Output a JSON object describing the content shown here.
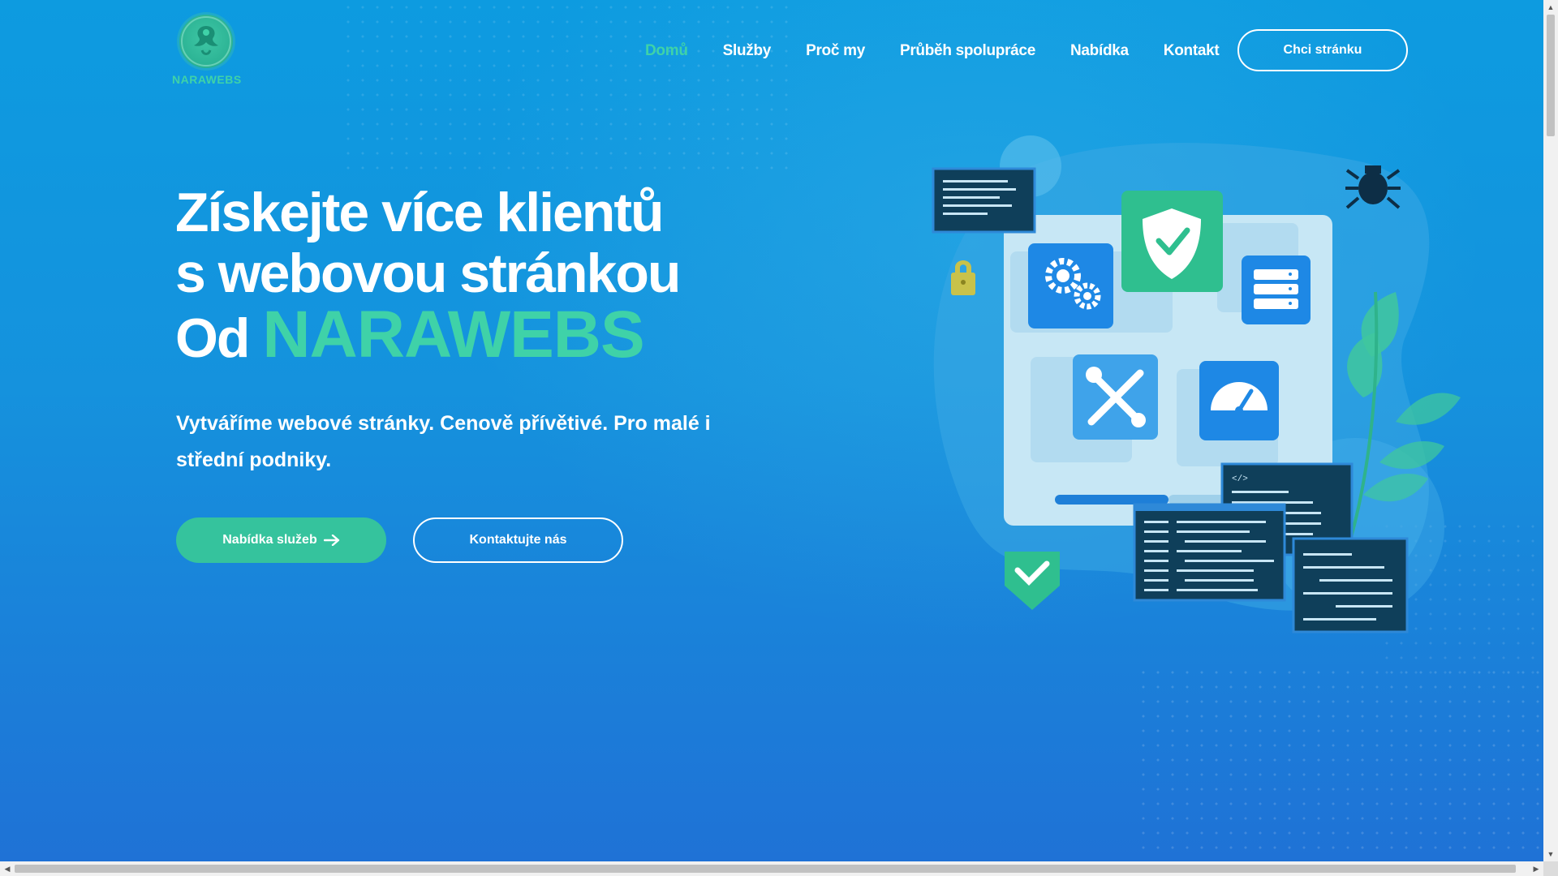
{
  "header": {
    "logo_text": "NARAWEBS",
    "nav": [
      {
        "label": "Domů",
        "active": true
      },
      {
        "label": "Služby",
        "active": false
      },
      {
        "label": "Proč my",
        "active": false
      },
      {
        "label": "Průběh spolupráce",
        "active": false
      },
      {
        "label": "Nabídka",
        "active": false
      },
      {
        "label": "Kontakt",
        "active": false
      }
    ],
    "cta_label": "Chci stránku"
  },
  "hero": {
    "title_line1": "Získejte více klientů",
    "title_line2": "s webovou stránkou",
    "title_line3_prefix": "Od",
    "title_brand": "NARAWEBS",
    "subtitle": "Vytváříme webové stránky. Cenově přívětivé. Pro malé i střední podniky.",
    "primary_button": "Nabídka služeb",
    "primary_button_icon": "arrow-right-icon",
    "secondary_button": "Kontaktujte nás"
  },
  "illustration": {
    "code_tag": "</>",
    "icons": [
      "shield-check-icon",
      "gears-icon",
      "server-icon",
      "tools-icon",
      "speedometer-icon",
      "lock-icon",
      "bug-icon",
      "leaf-icon"
    ]
  },
  "colors": {
    "accent": "#3fd2a8",
    "button_green": "#35c39d",
    "background_top": "#0d9be0",
    "background_bottom": "#1f72d6"
  }
}
